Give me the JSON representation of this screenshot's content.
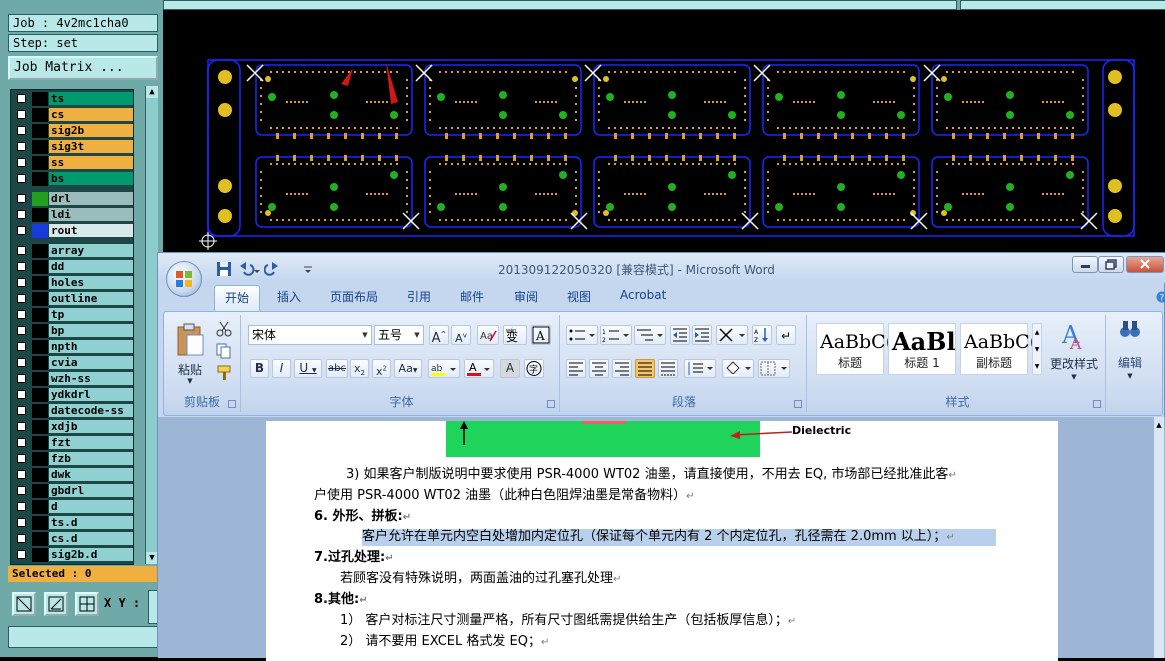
{
  "genesis": {
    "job": "Job : 4v2mc1cha0",
    "step": "Step: set",
    "job_matrix_button": "Job Matrix ...",
    "layers": [
      {
        "name": "ts",
        "color": "#009a6e",
        "marker": "#000000"
      },
      {
        "name": "cs",
        "color": "#f0b040",
        "marker": "#000000"
      },
      {
        "name": "sig2b",
        "color": "#f0b040",
        "marker": "#000000"
      },
      {
        "name": "sig3t",
        "color": "#f0b040",
        "marker": "#000000"
      },
      {
        "name": "ss",
        "color": "#f0b040",
        "marker": "#000000"
      },
      {
        "name": "bs",
        "color": "#009a6e",
        "marker": "#000000"
      },
      {
        "name": "drl",
        "color": "#9cbcbc",
        "marker": "#21a021"
      },
      {
        "name": "ldi",
        "color": "#9cbcbc",
        "marker": "#000000"
      },
      {
        "name": "rout",
        "color": "#d9e8e8",
        "marker": "#1a3adc"
      },
      {
        "name": "array",
        "color": "#8fd0d0",
        "marker": "#000000"
      },
      {
        "name": "dd",
        "color": "#8fd0d0",
        "marker": "#000000"
      },
      {
        "name": "holes",
        "color": "#8fd0d0",
        "marker": "#000000"
      },
      {
        "name": "outline",
        "color": "#8fd0d0",
        "marker": "#000000"
      },
      {
        "name": "tp",
        "color": "#8fd0d0",
        "marker": "#000000"
      },
      {
        "name": "bp",
        "color": "#8fd0d0",
        "marker": "#000000"
      },
      {
        "name": "npth",
        "color": "#8fd0d0",
        "marker": "#000000"
      },
      {
        "name": "cvia",
        "color": "#8fd0d0",
        "marker": "#000000"
      },
      {
        "name": "wzh-ss",
        "color": "#8fd0d0",
        "marker": "#000000"
      },
      {
        "name": "ydkdrl",
        "color": "#8fd0d0",
        "marker": "#000000"
      },
      {
        "name": "datecode-ss",
        "color": "#8fd0d0",
        "marker": "#000000"
      },
      {
        "name": "xdjb",
        "color": "#8fd0d0",
        "marker": "#000000"
      },
      {
        "name": "fzt",
        "color": "#8fd0d0",
        "marker": "#000000"
      },
      {
        "name": "fzb",
        "color": "#8fd0d0",
        "marker": "#000000"
      },
      {
        "name": "dwk",
        "color": "#8fd0d0",
        "marker": "#000000"
      },
      {
        "name": "gbdrl",
        "color": "#8fd0d0",
        "marker": "#000000"
      },
      {
        "name": "d",
        "color": "#8fd0d0",
        "marker": "#000000"
      },
      {
        "name": "ts.d",
        "color": "#8fd0d0",
        "marker": "#000000"
      },
      {
        "name": "cs.d",
        "color": "#8fd0d0",
        "marker": "#000000"
      },
      {
        "name": "sig2b.d",
        "color": "#8fd0d0",
        "marker": "#000000"
      }
    ],
    "selected": "Selected : 0",
    "xy_label": "X Y :"
  },
  "word": {
    "title": "201309122050320 [兼容模式] - Microsoft Word",
    "tabs": [
      "开始",
      "插入",
      "页面布局",
      "引用",
      "邮件",
      "审阅",
      "视图",
      "Acrobat"
    ],
    "groups": {
      "clipboard": "剪贴板",
      "font": "字体",
      "paragraph": "段落",
      "styles": "样式"
    },
    "paste_label": "粘贴",
    "font_name": "宋体",
    "font_size": "五号",
    "styles": [
      {
        "sample": "AaBbC(",
        "name": "标题"
      },
      {
        "sample": "AaBl",
        "name": "标题 1"
      },
      {
        "sample": "AaBbC(",
        "name": "副标题"
      }
    ],
    "change_styles": "更改样式",
    "edit": "编辑",
    "figure_label": "Dielectric",
    "doc_lines": [
      "3) 如果客户制版说明中要求使用 PSR-4000 WT02 油墨，请直接使用，不用去 EQ, 市场部已经批准此客",
      "户使用 PSR-4000 WT02 油墨（此种白色阻焊油墨是常备物料）",
      "6.   外形、拼板:",
      "客户允许在单元内空白处增加内定位孔（保证每个单元内有 2 个内定位孔，孔径需在 2.0mm 以上）；",
      "7.过孔处理:",
      "若顾客没有特殊说明，两面盖油的过孔塞孔处理",
      "8.其他:",
      "1） 客户对标注尺寸测量严格，所有尺寸图纸需提供给生产（包括板厚信息）；",
      "2） 请不要用 EXCEL 格式发 EQ；"
    ]
  }
}
